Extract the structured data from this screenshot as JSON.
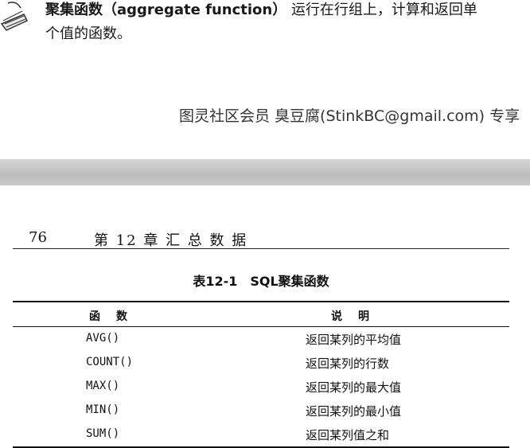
{
  "top_page": {
    "definition_term": "聚集函数（aggregate function）",
    "definition_text_line1": "运行在行组上，计算和返回单",
    "definition_text_line2": "个值的函数。",
    "watermark": "图灵社区会员 臭豆腐(StinkBC@gmail.com) 专享"
  },
  "bottom_page": {
    "page_number": "76",
    "chapter_title": "第 12 章   汇 总 数 据",
    "table_caption": "表12-1　SQL聚集函数",
    "table": {
      "headers": [
        "函数",
        "说明"
      ],
      "rows": [
        {
          "function": "AVG()",
          "description": "返回某列的平均值"
        },
        {
          "function": "COUNT()",
          "description": "返回某列的行数"
        },
        {
          "function": "MAX()",
          "description": "返回某列的最大值"
        },
        {
          "function": "MIN()",
          "description": "返回某列的最小值"
        },
        {
          "function": "SUM()",
          "description": "返回某列值之和"
        }
      ]
    }
  }
}
